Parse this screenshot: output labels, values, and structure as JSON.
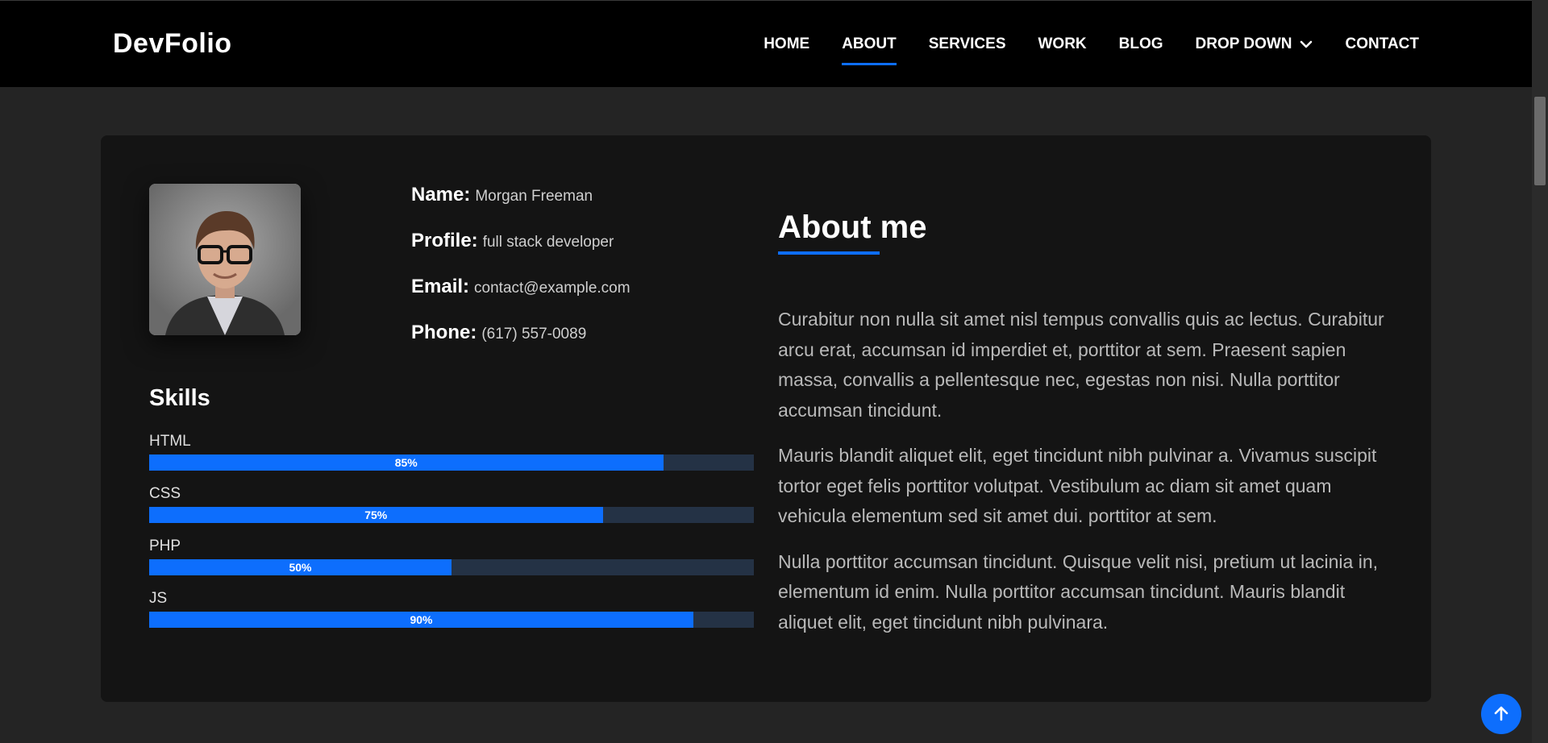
{
  "header": {
    "logo": "DevFolio",
    "nav": [
      {
        "label": "HOME",
        "active": false
      },
      {
        "label": "ABOUT",
        "active": true
      },
      {
        "label": "SERVICES",
        "active": false
      },
      {
        "label": "WORK",
        "active": false
      },
      {
        "label": "BLOG",
        "active": false
      },
      {
        "label": "DROP DOWN",
        "active": false,
        "has_dropdown": true
      },
      {
        "label": "CONTACT",
        "active": false
      }
    ]
  },
  "profile": {
    "name_label": "Name:",
    "name_value": "Morgan Freeman",
    "profile_label": "Profile:",
    "profile_value": "full stack developer",
    "email_label": "Email:",
    "email_value": "contact@example.com",
    "phone_label": "Phone:",
    "phone_value": "(617) 557-0089"
  },
  "skills": {
    "title": "Skills",
    "items": [
      {
        "name": "HTML",
        "percent_label": "85%",
        "value": 0.85
      },
      {
        "name": "CSS",
        "percent_label": "75%",
        "value": 0.75
      },
      {
        "name": "PHP",
        "percent_label": "50%",
        "value": 0.5
      },
      {
        "name": "JS",
        "percent_label": "90%",
        "value": 0.9
      }
    ]
  },
  "about": {
    "title": "About me",
    "paragraphs": [
      "Curabitur non nulla sit amet nisl tempus convallis quis ac lectus. Curabitur arcu erat, accumsan id imperdiet et, porttitor at sem. Praesent sapien massa, convallis a pellentesque nec, egestas non nisi. Nulla porttitor accumsan tincidunt.",
      "Mauris blandit aliquet elit, eget tincidunt nibh pulvinar a. Vivamus suscipit tortor eget felis porttitor volutpat. Vestibulum ac diam sit amet quam vehicula elementum sed sit amet dui. porttitor at sem.",
      "Nulla porttitor accumsan tincidunt. Quisque velit nisi, pretium ut lacinia in, elementum id enim. Nulla porttitor accumsan tincidunt. Mauris blandit aliquet elit, eget tincidunt nibh pulvinara."
    ]
  },
  "icons": {
    "dropdown": "chevron-down-icon",
    "back_to_top": "arrow-up-icon"
  },
  "colors": {
    "accent": "#0d6efd",
    "nav_bg": "#000000",
    "page_bg": "#242424",
    "card_bg": "#141414",
    "bar_track": "#243245"
  }
}
